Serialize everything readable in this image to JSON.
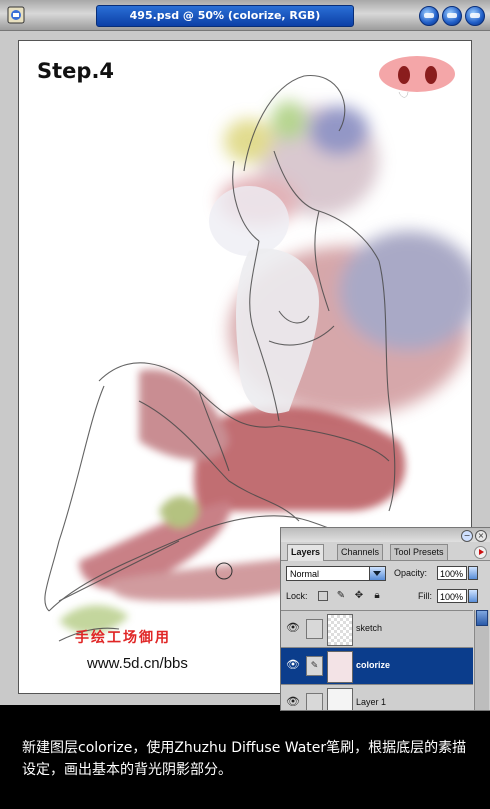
{
  "window": {
    "title": "495.psd @ 50% (colorize, RGB)"
  },
  "canvas": {
    "step_label": "Step.4",
    "signature": "手绘工场御用",
    "url": "www.5d.cn/bbs"
  },
  "layers_panel": {
    "tabs": [
      "Layers",
      "Channels",
      "Tool Presets"
    ],
    "blend_mode": "Normal",
    "opacity_label": "Opacity:",
    "opacity_value": "100%",
    "lock_label": "Lock:",
    "fill_label": "Fill:",
    "fill_value": "100%",
    "layers": [
      {
        "name": "sketch",
        "selected": false
      },
      {
        "name": "colorize",
        "selected": true
      },
      {
        "name": "Layer 1",
        "selected": false
      }
    ]
  },
  "caption": "新建图层colorize，使用Zhuzhu Diffuse Water笔刷，根据底层的素描设定，画出基本的背光阴影部分。",
  "colors": {
    "title_bar": "#0c3fa6",
    "selected_layer": "#0b3d8c",
    "watercolor_red": "#b7545a",
    "caption_bg": "#000000"
  }
}
